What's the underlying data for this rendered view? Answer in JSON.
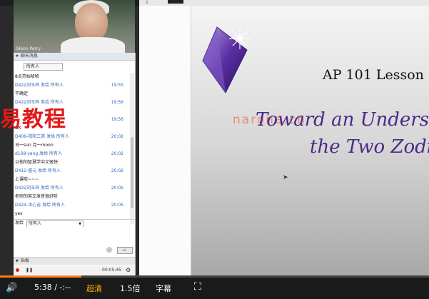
{
  "webcam": {
    "presenter_name": "Glenn Perry"
  },
  "chat": {
    "header": "聊天消息",
    "filter": "所有人",
    "messages": [
      {
        "text": "8点开始哈哈",
        "time": ""
      },
      {
        "text": "D422刘玉梓 发给 所有人",
        "time": "19:55",
        "meta": true
      },
      {
        "text": "不确定",
        "time": ""
      },
      {
        "text": "D422刘玉梓 发给 所有人",
        "time": "19:56",
        "meta": true
      },
      {
        "text": "",
        "time": ""
      },
      {
        "text": "",
        "time": "19:56",
        "meta": true
      },
      {
        "text": "OK",
        "time": ""
      },
      {
        "text": "D406-阳阳三首 发给 所有人",
        "time": "20:02",
        "meta": true
      },
      {
        "text": "日一sun 月一moon",
        "time": ""
      },
      {
        "text": "d168-yang 发给 所有人",
        "time": "20:02",
        "meta": true
      },
      {
        "text": "以他的智慧学中文很快",
        "time": ""
      },
      {
        "text": "D412-盛元 发给 所有人",
        "time": "20:02",
        "meta": true
      },
      {
        "text": "上课啦~~~",
        "time": ""
      },
      {
        "text": "D422刘玉梓 发给 所有人",
        "time": "20:05",
        "meta": true
      },
      {
        "text": "老师的英文发音很好听",
        "time": ""
      },
      {
        "text": "D424-沐心吉 发给 所有人",
        "time": "20:05",
        "meta": true
      },
      {
        "text": "yes",
        "time": ""
      }
    ],
    "send_label": "发给",
    "send_target": "所有人",
    "send_button": "↵",
    "notes_header": "贴板",
    "rec_time": "00:05:45"
  },
  "watermark_left": "易教程",
  "slide": {
    "title": "AP 101 Lesson",
    "line1": "Toward an Underst",
    "line2": "the Two Zodi",
    "watermark": "narona.cn"
  },
  "player": {
    "progress": 0.19,
    "volume_icon": "🔊",
    "time": "5:38 / -:--",
    "quality": "超清",
    "speed": "1.5倍",
    "captions": "字幕",
    "fullscreen_icon": "⛶"
  },
  "colors": {
    "accent": "#ff7a1a",
    "slide_text": "#4a2a86",
    "meta_blue": "#2b68b8"
  }
}
